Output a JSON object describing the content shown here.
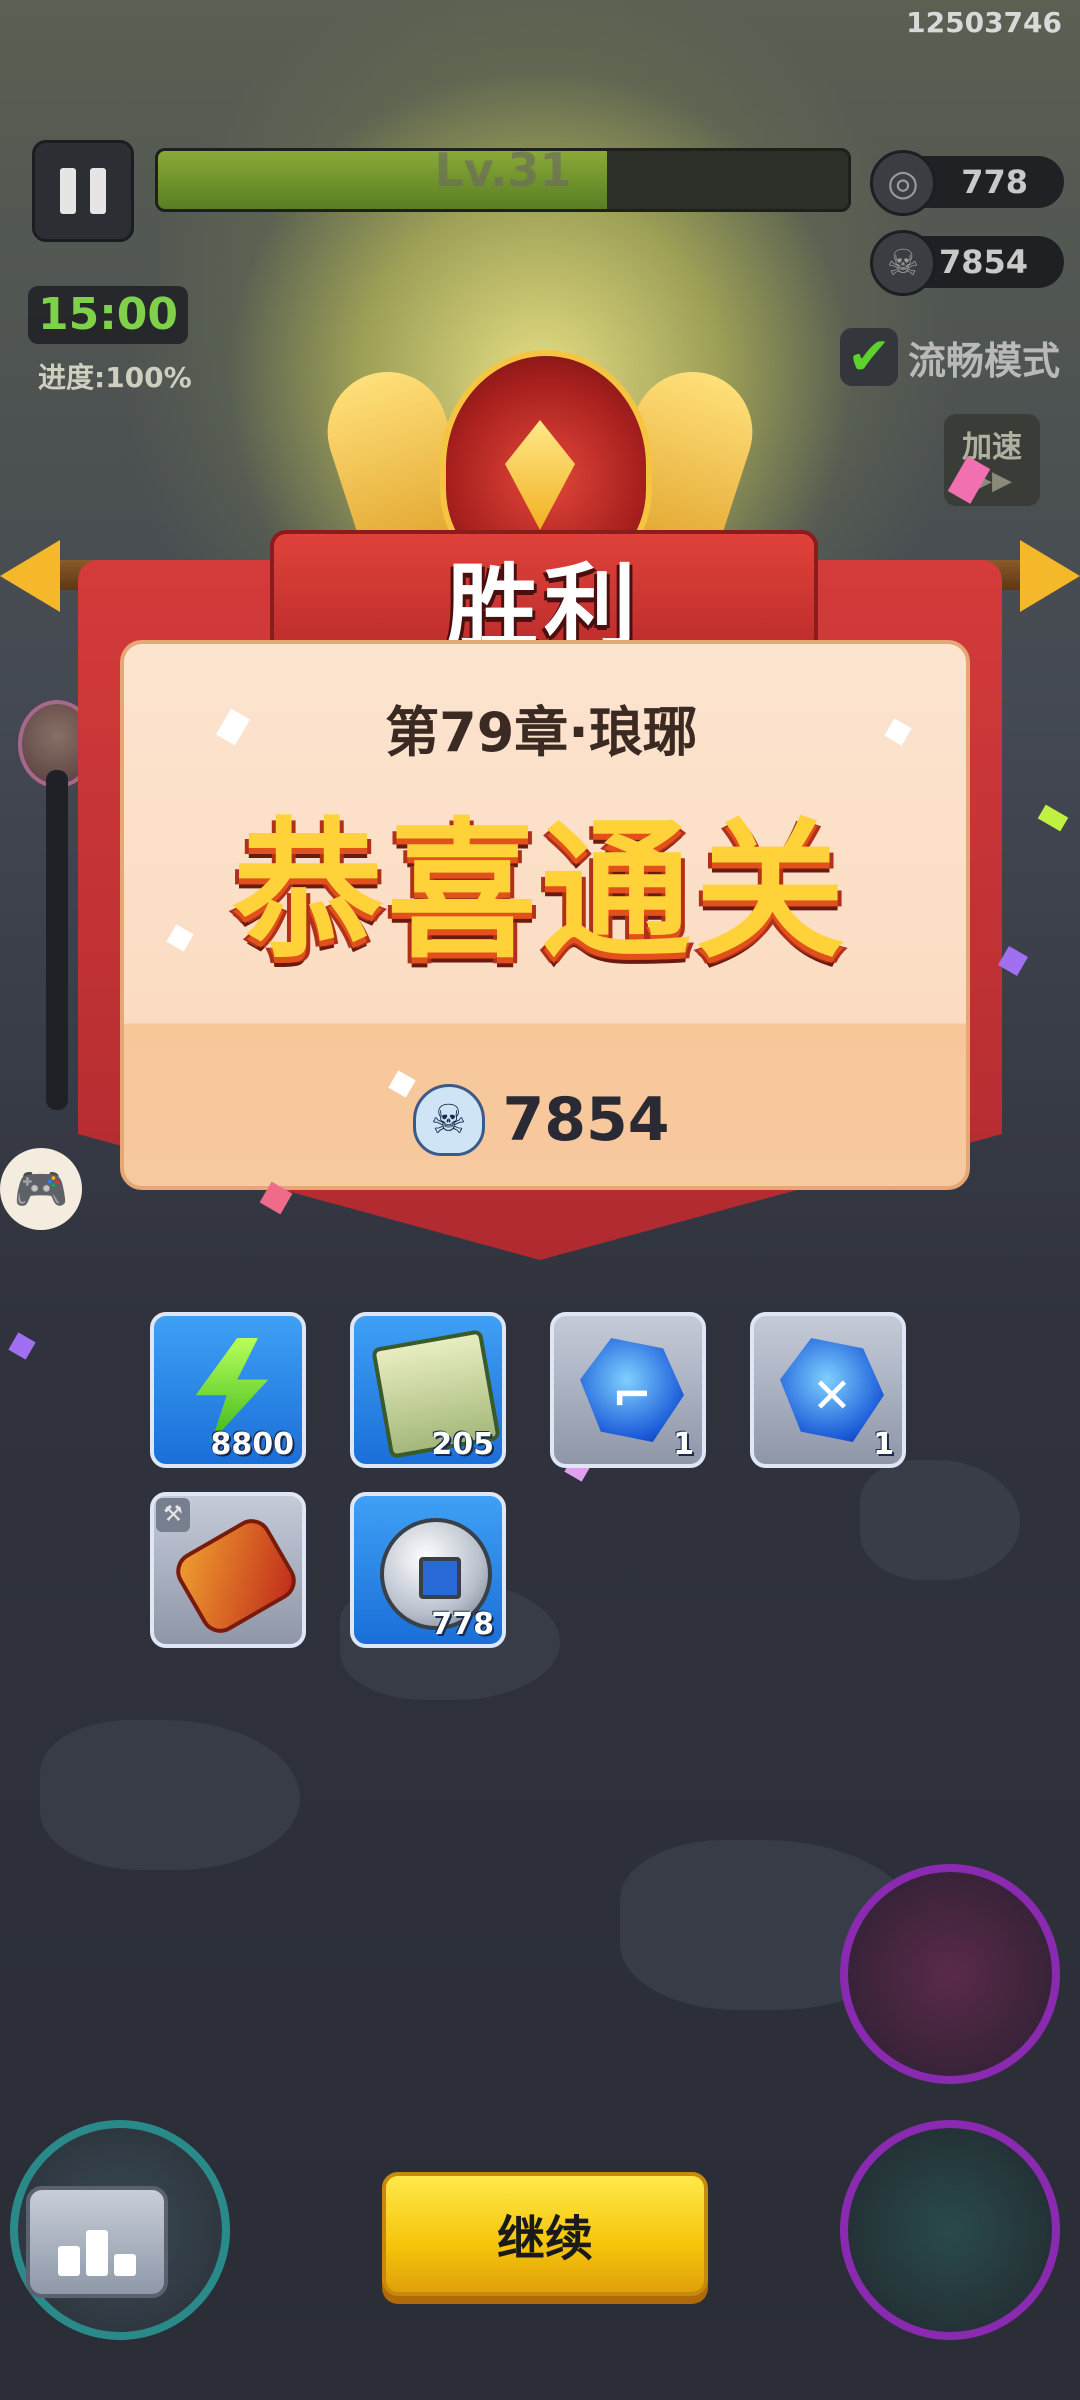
{
  "hud": {
    "user_id": "12503746",
    "level_label": "Lv.31",
    "level_progress_percent": 65,
    "coins": "778",
    "kills": "7854",
    "timer": "15:00",
    "progress": "进度:100%",
    "smooth_mode": "流畅模式",
    "speed_up": "加速"
  },
  "victory": {
    "title": "胜利",
    "chapter": "第79章·琅琊",
    "congrats": "恭喜通关",
    "kill_count": "7854"
  },
  "rewards": [
    {
      "name": "energy",
      "qty": "8800",
      "style": "blue"
    },
    {
      "name": "scroll",
      "qty": "205",
      "style": "blue"
    },
    {
      "name": "boot-crystal",
      "qty": "1",
      "style": "gray"
    },
    {
      "name": "sword-crystal",
      "qty": "1",
      "style": "gray"
    },
    {
      "name": "gem-equipment",
      "qty": "",
      "style": "gray"
    },
    {
      "name": "silver-coin",
      "qty": "778",
      "style": "blue"
    }
  ],
  "buttons": {
    "continue": "继续"
  },
  "colors": {
    "accent_yellow": "#f5c40a",
    "banner_red": "#c4302f",
    "reward_blue": "#1a6fd8"
  }
}
